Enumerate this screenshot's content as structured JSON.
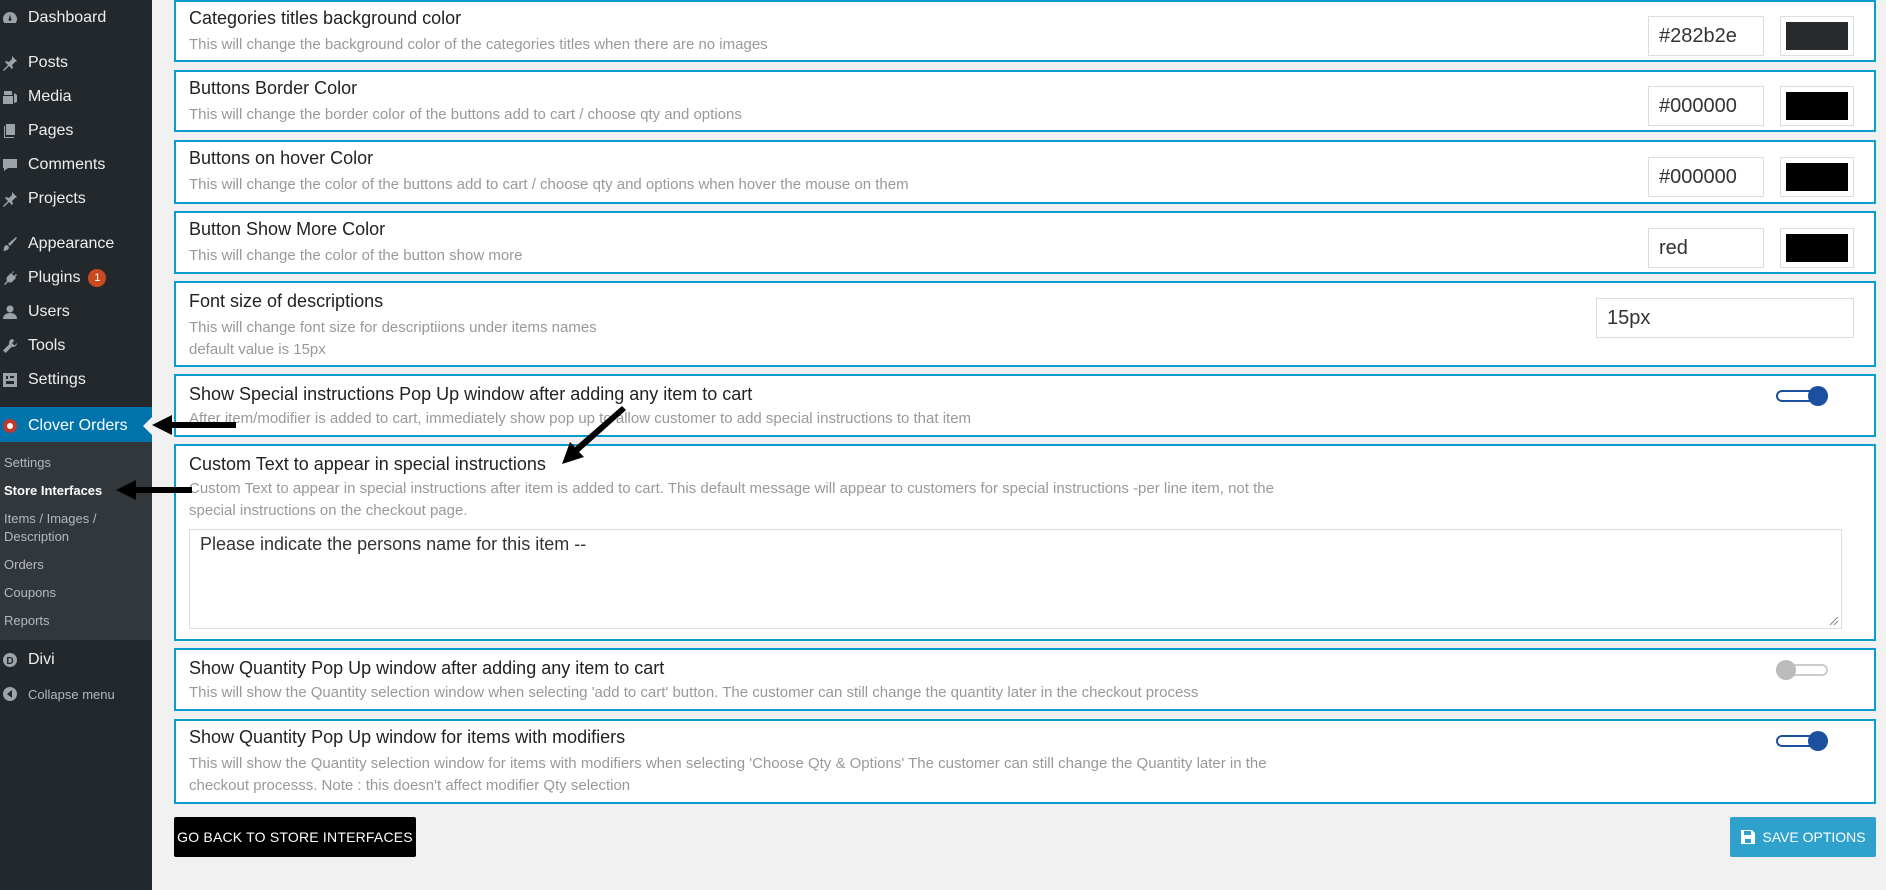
{
  "sidebar": {
    "items": [
      {
        "label": "Dashboard",
        "icon": "dashboard-icon"
      },
      {
        "label": "Posts",
        "icon": "pin-icon"
      },
      {
        "label": "Media",
        "icon": "media-icon"
      },
      {
        "label": "Pages",
        "icon": "pages-icon"
      },
      {
        "label": "Comments",
        "icon": "comment-icon"
      },
      {
        "label": "Projects",
        "icon": "pin-icon"
      },
      {
        "label": "Appearance",
        "icon": "brush-icon"
      },
      {
        "label": "Plugins",
        "icon": "plug-icon",
        "badge": "1"
      },
      {
        "label": "Users",
        "icon": "user-icon"
      },
      {
        "label": "Tools",
        "icon": "wrench-icon"
      },
      {
        "label": "Settings",
        "icon": "settings-icon"
      },
      {
        "label": "Clover Orders",
        "icon": "clover-icon"
      }
    ],
    "submenu": [
      {
        "label": "Settings"
      },
      {
        "label": "Store Interfaces"
      },
      {
        "label": "Items / Images / Description"
      },
      {
        "label": "Orders"
      },
      {
        "label": "Coupons"
      },
      {
        "label": "Reports"
      }
    ],
    "bottom": [
      {
        "label": "Divi",
        "icon": "divi-icon"
      },
      {
        "label": "Collapse menu",
        "icon": "collapse-icon"
      }
    ]
  },
  "options": {
    "cat_titles_bg": {
      "title": "Categories titles background color",
      "desc": "This will change the background color of the categories titles when there are no images",
      "value": "#282b2e",
      "swatch": "#282b2e"
    },
    "buttons_border": {
      "title": "Buttons Border Color",
      "desc": "This will change the border color of the buttons add to cart / choose qty and options",
      "value": "#000000",
      "swatch": "#000000"
    },
    "buttons_hover": {
      "title": "Buttons on hover Color",
      "desc": "This will change the color of the buttons add to cart / choose qty and options when hover the mouse on them",
      "value": "#000000",
      "swatch": "#000000"
    },
    "show_more": {
      "title": "Button Show More Color",
      "desc": "This will change the color of the button show more",
      "value": "red",
      "swatch": "#000000"
    },
    "font_size": {
      "title": "Font size of descriptions",
      "desc1": "This will change font size for descriptiions under items names",
      "desc2": "default value is 15px",
      "value": "15px"
    },
    "special_popup": {
      "title": "Show Special instructions Pop Up window after adding any item to cart",
      "desc": "After item/modifier is added to cart, immediately show pop up to allow customer to add special instructions to that item",
      "enabled": true
    },
    "custom_text": {
      "title": "Custom Text to appear in special instructions",
      "desc1": "Custom Text to appear in special instructions after item is added to cart. This default message will appear to customers for special instructions -per line item, not the",
      "desc2": "special instructions on the checkout page.",
      "value": "Please indicate the persons name for this item --"
    },
    "qty_popup": {
      "title": "Show Quantity Pop Up window after adding any item to cart",
      "desc": "This will show the Quantity selection window when selecting 'add to cart' button. The customer can still change the quantity later in the checkout process",
      "enabled": false
    },
    "qty_modifiers": {
      "title": "Show Quantity Pop Up window for items with modifiers",
      "desc1": "This will show the Quantity selection window for items with modifiers when selecting 'Choose Qty & Options' The customer can still change the Quantity later in the",
      "desc2": "checkout processs. Note : this doesn't affect modifier Qty selection",
      "enabled": true
    }
  },
  "footer": {
    "back_label": "GO BACK TO STORE INTERFACES",
    "save_label": "SAVE OPTIONS"
  },
  "colors": {
    "accent": "#0a9ecf",
    "sidebar_bg": "#23282d",
    "active_menu": "#0073aa",
    "toggle_on": "#1b4fa0",
    "save_button": "#2ea2cc"
  }
}
